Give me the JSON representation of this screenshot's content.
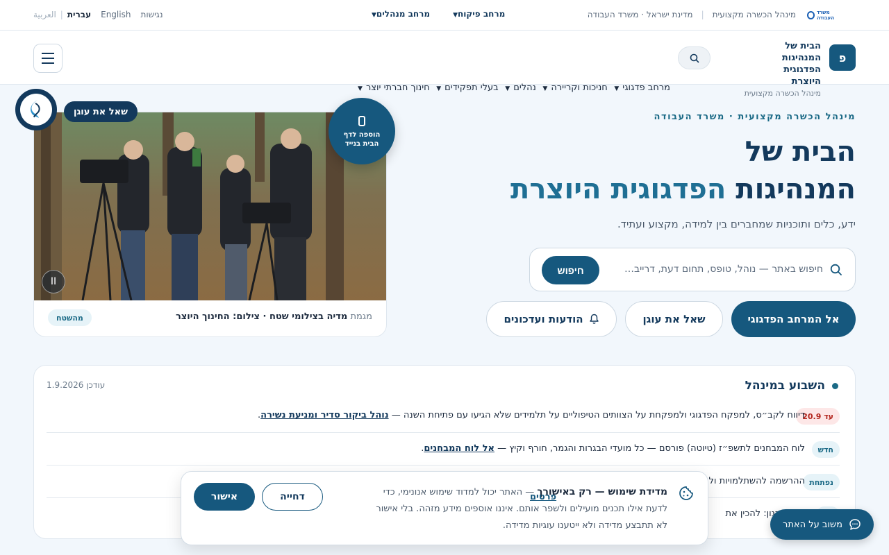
{
  "topbar": {
    "gov_name": "מדינת ישראל · משרד העבודה",
    "sep": "|",
    "admin_name": "מינהל הכשרה מקצועית",
    "spaces": [
      {
        "label": "מרחב פיקוח"
      },
      {
        "label": "מרחב מנהלים"
      }
    ],
    "langs": [
      "נגישות",
      "English",
      "עברית",
      "|",
      "العربية"
    ]
  },
  "header": {
    "brand_letter": "פ",
    "brand_line1": "הבית של המנהיגות הפדגוגית היוצרת",
    "brand_line2": "מינהל הכשרה מקצועית",
    "nav": [
      {
        "label": "מרחב פדגוגי"
      },
      {
        "label": "חניכות וקריירה"
      },
      {
        "label": "נהלים"
      },
      {
        "label": "בעלי תפקידים"
      },
      {
        "label": "חינוך חברתי יוצר"
      }
    ]
  },
  "hero": {
    "eyebrow": "מינהל הכשרה מקצועית · משרד העבודה",
    "title_line1": "הבית של",
    "title_line2a": "המנהיגות ",
    "title_line2b": "הפדגוגית היוצרת",
    "subtitle": "ידע, כלים ותוכניות שמחברים בין למידה, מקצוע ועתיד.",
    "search": {
      "placeholder": "חיפוש באתר — נוהל, טופס, תחום דעת, דרייב…",
      "button": "חיפוש"
    },
    "cta_primary": "אל המרחב הפדגוגי",
    "cta_ask": "שאל את עוגן",
    "cta_news": "הודעות ועדכונים"
  },
  "media": {
    "caption_label": "מגמת",
    "caption_text": "מדיה בצילומי שטח · צילום: החינוך היוצר",
    "tag": "מהשטח",
    "pause": "II",
    "badge_line1": "הוספה לדף",
    "badge_line2": "הבית בנייד"
  },
  "assistant": {
    "bubble": "שאל את עוגן"
  },
  "weekly": {
    "title": "השבוע במינהל",
    "updated": "עודכן 1.9.2026",
    "items": [
      {
        "badge": "עד 20.9",
        "text": "דיווח לקב״ס, למפקח הפדגוגי ולמפקחת על הצוותים הטיפוליים על תלמידים שלא הגיעו עם פתיחת השנה —",
        "link": "נוהל ביקור סדיר ומניעת נשירה",
        "tail": "."
      },
      {
        "badge": "חדש",
        "text": "לוח המבחנים לתשפ״ז (טיוטה) פורסם — כל מועדי הבגרות והגמר, חורף וקיץ —",
        "link": "אל לוח המבחנים",
        "tail": "."
      },
      {
        "badge": "נפתחת",
        "text": "ההרשמה להשתלמויות ול",
        "link": "",
        "tail": ""
      },
      {
        "badge": "",
        "text": "יום התכנון: להכין את",
        "link": "",
        "tail": ""
      }
    ]
  },
  "cookie": {
    "title": "מדידת שימוש — רק באישורך",
    "body": " — האתר יכול למדוד שימוש אנונימי, כדי לדעת אילו תכנים מועילים ולשפר אותם. איננו אוספים מידע מזהה. בלי אישור לא תתבצע מדידה ולא ייטענו עוגיות מדידה.",
    "details": "פרטים",
    "reject": "דחייה",
    "accept": "אישור"
  },
  "feedback": {
    "label": "משוב על האתר"
  },
  "colors": {
    "primary": "#16587e",
    "navy": "#13395c",
    "accent_teal": "#1b6a86",
    "page_bg": "#f2f7fc"
  }
}
